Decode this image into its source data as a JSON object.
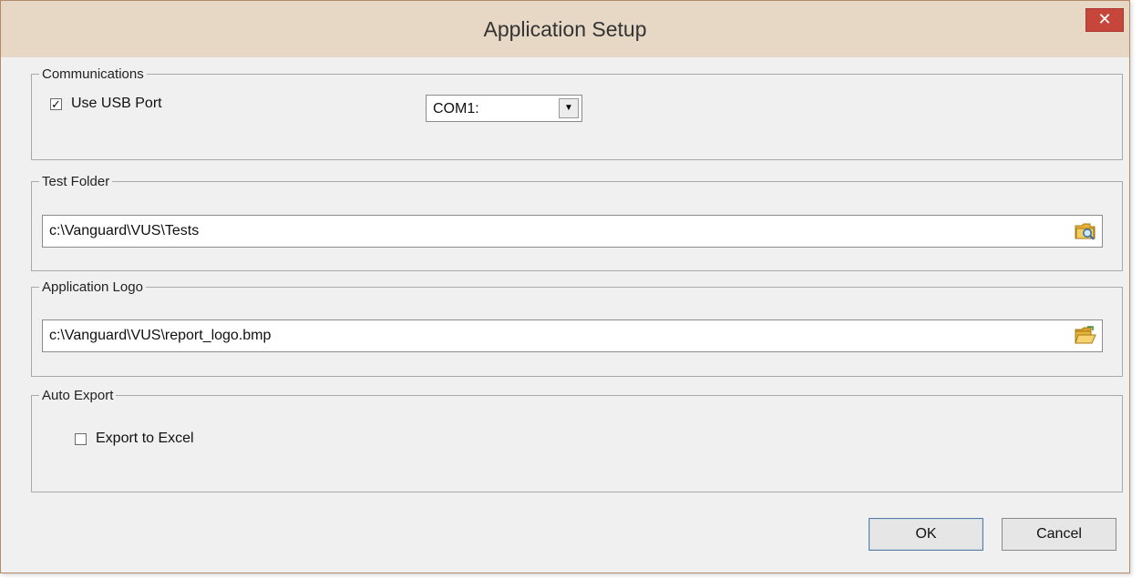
{
  "window": {
    "title": "Application Setup",
    "close_label": "✕"
  },
  "communications": {
    "legend": "Communications",
    "use_usb": {
      "label": "Use USB Port",
      "checked": true
    },
    "port_select": {
      "selected": "COM1:"
    }
  },
  "test_folder": {
    "legend": "Test Folder",
    "path": "c:\\Vanguard\\VUS\\Tests",
    "browse_icon": "folder-search-icon"
  },
  "application_logo": {
    "legend": "Application Logo",
    "path": "c:\\Vanguard\\VUS\\report_logo.bmp",
    "browse_icon": "folder-open-icon"
  },
  "auto_export": {
    "legend": "Auto Export",
    "export_to_excel": {
      "label": "Export to Excel",
      "checked": false
    }
  },
  "buttons": {
    "ok": "OK",
    "cancel": "Cancel"
  },
  "colors": {
    "titlebar": "#e7d7c5",
    "close": "#c7463b",
    "dialog_bg": "#f0f0f0",
    "folder": "#e8b33a"
  }
}
